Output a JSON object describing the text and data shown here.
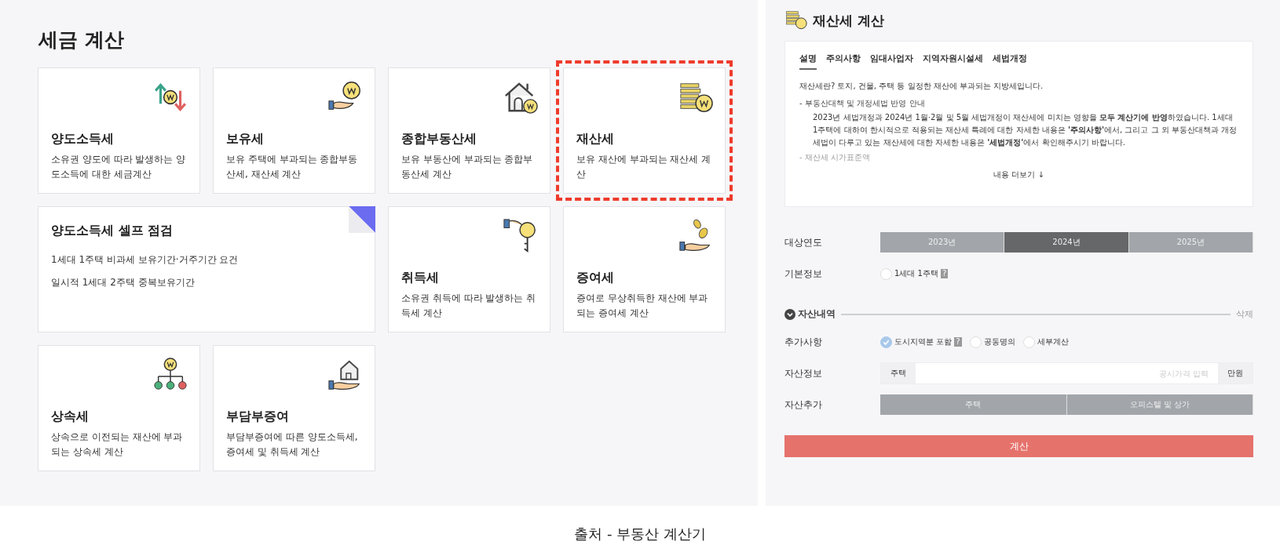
{
  "left": {
    "title": "세금 계산",
    "cards": [
      {
        "kind": "transfer",
        "title": "양도소득세",
        "desc": "소유권 양도에 따라 발생하는 양도소득에 대한 세금계산",
        "highlighted": false
      },
      {
        "kind": "holding",
        "title": "보유세",
        "desc": "보유 주택에 부과되는 종합부동산세, 재산세 계산",
        "highlighted": false
      },
      {
        "kind": "realestate",
        "title": "종합부동산세",
        "desc": "보유 부동산에 부과되는 종합부동산세 계산",
        "highlighted": false
      },
      {
        "kind": "property",
        "title": "재산세",
        "desc": "보유 재산에 부과되는 재산세 계산",
        "highlighted": true
      },
      {
        "kind": "selfcheck",
        "title": "양도소득세 셀프 점검",
        "lines": [
          "1세대 1주택 비과세 보유기간·거주기간 요건",
          "일시적 1세대 2주택 중복보유기간"
        ],
        "highlighted": false
      },
      {
        "kind": "acquisition",
        "title": "취득세",
        "desc": "소유권 취득에 따라 발생하는 취득세 계산",
        "highlighted": false
      },
      {
        "kind": "gift",
        "title": "증여세",
        "desc": "증여로 무상취득한 재산에 부과되는 증여세 계산",
        "highlighted": false
      },
      {
        "kind": "inheritance",
        "title": "상속세",
        "desc": "상속으로 이전되는 재산에 부과되는 상속세 계산",
        "highlighted": false
      },
      {
        "kind": "burden",
        "title": "부담부증여",
        "desc": "부담부증여에 따른 양도소득세, 증여세 및 취득세 계산",
        "highlighted": false
      }
    ]
  },
  "right": {
    "title": "재산세 계산",
    "tabs": [
      {
        "label": "설명",
        "selected": true
      },
      {
        "label": "주의사항",
        "selected": false
      },
      {
        "label": "임대사업자",
        "selected": false
      },
      {
        "label": "지역자원시설세",
        "selected": false
      },
      {
        "label": "세법개정",
        "selected": false
      }
    ],
    "intro": "재산세란? 토지, 건물, 주택 등 일정한 재산에 부과되는 지방세입니다.",
    "notice_heading": "- 부동산대책 및 개정세법 반영 안내",
    "notice_body": "2023년 세법개정과 2024년 1월·2월 및 5월 세법개정이 재산세에 미치는 영향을 **모두 계산기에 반영**하였습니다. 1세대 1주택에 대하여 한시적으로 적용되는 재산세 특례에 대한 자세한 내용은 **'주의사항'**에서, 그리고 그 외 부동산대책과 개정세법이 다루고 있는 재산세에 대한 자세한 내용은 **'세법개정'**에서 확인해주시기 바랍니다.",
    "faded_heading": "- 재산세 시가표준액",
    "more": "내용 더보기",
    "more_arrow": "↓",
    "year_label": "대상연도",
    "years": [
      {
        "label": "2023년",
        "selected": false
      },
      {
        "label": "2024년",
        "selected": true
      },
      {
        "label": "2025년",
        "selected": false
      }
    ],
    "basic_label": "기본정보",
    "basic_options": [
      {
        "label": "1세대 1주택",
        "checked": false,
        "help": "?"
      }
    ],
    "section_title": "자산내역",
    "delete": "삭제",
    "extra_label": "추가사항",
    "extra_options": [
      {
        "label": "도시지역분 포함",
        "checked": true,
        "help": "?"
      },
      {
        "label": "공동명의",
        "checked": false
      },
      {
        "label": "세부계산",
        "checked": false
      }
    ],
    "asset_label": "자산정보",
    "asset_prefix": "주택",
    "asset_placeholder": "공시가격 입력",
    "asset_unit": "만원",
    "add_label": "자산추가",
    "add_buttons": [
      "주택",
      "오피스텔 및 상가"
    ],
    "calc": "계산"
  },
  "caption": "출처 - 부동산 계산기"
}
